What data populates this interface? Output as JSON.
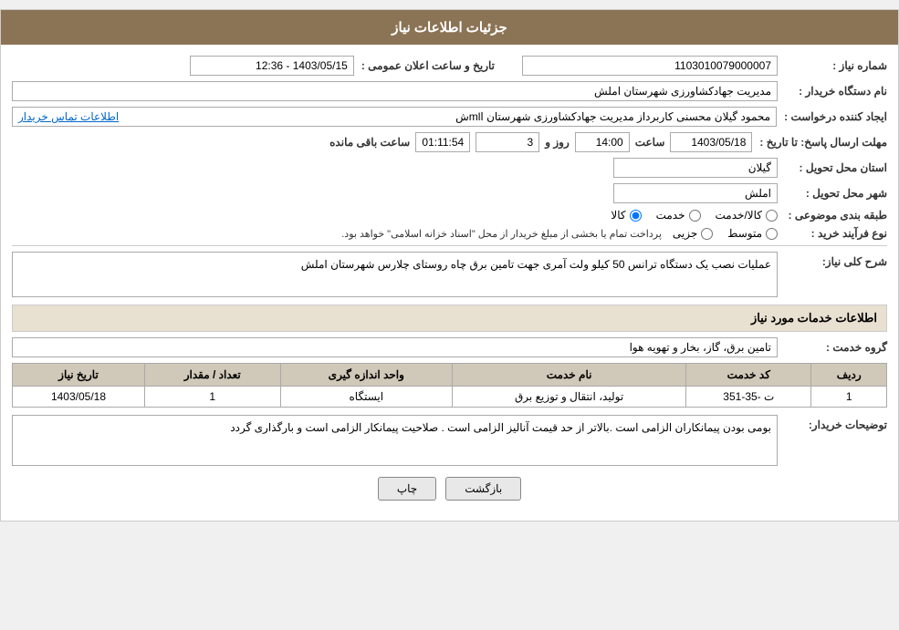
{
  "header": {
    "title": "جزئیات اطلاعات نیاز"
  },
  "fields": {
    "shomareNiaz_label": "شماره نیاز :",
    "shomareNiaz_value": "1103010079000007",
    "namDastgah_label": "نام دستگاه خریدار :",
    "namDastgah_value": "مدیریت جهادکشاورزی شهرستان املش",
    "ijadKonande_label": "ایجاد کننده درخواست :",
    "ijadKonande_value": "محمود گیلان محسنی کاربرداز مدیریت جهادکشاورزی شهرستان اmlش",
    "ettelaatTamas_label": "اطلاعات تماس خریدار",
    "mohlatErsalPasokh_label": "مهلت ارسال پاسخ: تا تاریخ :",
    "date_value": "1403/05/18",
    "saat_label": "ساعت",
    "saat_value": "14:00",
    "rooz_label": "روز و",
    "rooz_value": "3",
    "baghimande_label": "ساعت باقی مانده",
    "baghimande_value": "01:11:54",
    "ostan_label": "استان محل تحویل :",
    "ostan_value": "گیلان",
    "shahr_label": "شهر محل تحویل :",
    "shahr_value": "املش",
    "tabebandiMovzoi_label": "طبقه بندی موضوعی :",
    "noeFarayandKharid_label": "نوع فرآیند خرید :",
    "tarikh_va_saat_label": "تاریخ و ساعت اعلان عمومی :",
    "tarikh_va_saat_value": "1403/05/15 - 12:36",
    "radio_khidmat": "خدمت",
    "radio_kala": "کالا",
    "radio_kala_khidmat": "کالا/خدمت",
    "radio_jozi": "جزیی",
    "radio_motovaset": "متوسط",
    "note_payment": "پرداخت تمام یا بخشی از مبلغ خریدار از محل \"اسناد خزانه اسلامی\" خواهد بود.",
    "sharh_section": "شرح کلی نیاز:",
    "sharh_value": "عملیات نصب یک دستگاه ترانس 50 کیلو ولت آمری جهت تامین برق چاه روستای چلارس شهرستان املش",
    "khadamat_section": "اطلاعات خدمات مورد نیاز",
    "groheKhadamat_label": "گروه خدمت :",
    "groheKhadamat_value": "تامین برق، گاز، بخار و تهویه هوا",
    "table": {
      "headers": [
        "ردیف",
        "کد خدمت",
        "نام خدمت",
        "واحد اندازه گیری",
        "تعداد / مقدار",
        "تاریخ نیاز"
      ],
      "rows": [
        {
          "radif": "1",
          "kodKhadamat": "ت -35-351",
          "namKhadamat": "تولید، انتقال و توزیع برق",
          "vahedAndaze": "ایستگاه",
          "tedad": "1",
          "tarikhe": "1403/05/18"
        }
      ]
    },
    "توضیحات_label": "توضیحات خریدار:",
    "توضیحات_value": "بومی بودن پیمانکاران الزامی است .بالاتر از حد قیمت آنالیز الزامی است . صلاحیت پیمانکار الزامی است و بارگذاری گردد"
  },
  "buttons": {
    "print_label": "چاپ",
    "back_label": "بازگشت"
  }
}
